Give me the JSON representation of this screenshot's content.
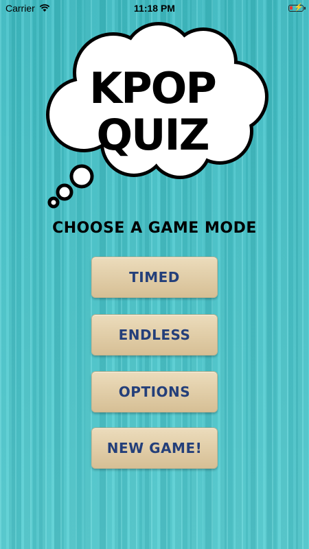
{
  "status_bar": {
    "carrier": "Carrier",
    "time": "11:18 PM"
  },
  "logo": {
    "line1": "KPOP",
    "line2": "QUIZ"
  },
  "menu": {
    "title": "CHOOSE A GAME MODE",
    "buttons": [
      {
        "label": "TIMED"
      },
      {
        "label": "ENDLESS"
      },
      {
        "label": "OPTIONS"
      },
      {
        "label": "NEW GAME!"
      }
    ]
  },
  "colors": {
    "background": "#49c7cd",
    "button_face": "#e0cca6",
    "button_text": "#243f7a",
    "battery_level": "#e53935"
  }
}
